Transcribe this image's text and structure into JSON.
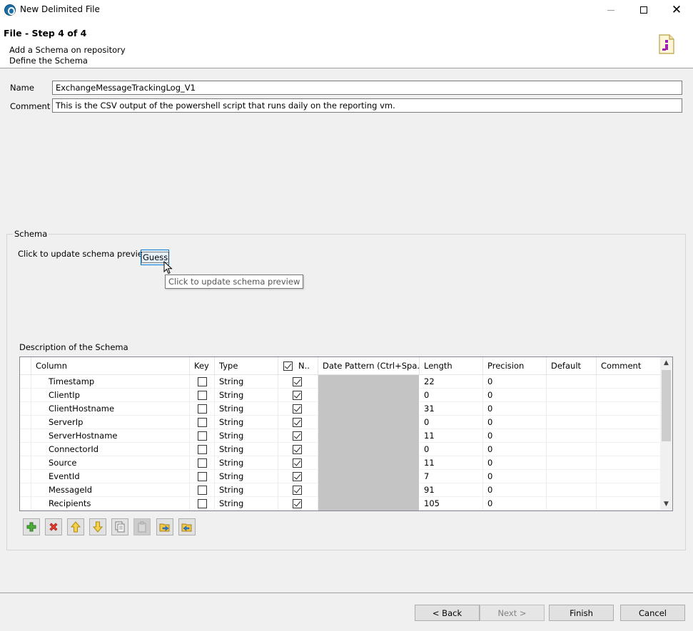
{
  "window": {
    "title": "New Delimited File",
    "minimize_glyph": "",
    "maximize_glyph": "",
    "close_glyph": "✕"
  },
  "header": {
    "step_title": "File - Step 4 of 4",
    "desc_line1": "Add a Schema on repository",
    "desc_line2": "Define the Schema"
  },
  "form": {
    "name_label": "Name",
    "name_value": "ExchangeMessageTrackingLog_V1",
    "comment_label": "Comment",
    "comment_value": "This is the CSV output of the powershell script that runs daily on the reporting vm."
  },
  "schema": {
    "group_label": "Schema",
    "guess_label": "Click to update schema preview",
    "guess_button": "Guess",
    "tooltip": "Click to update schema preview",
    "description_label": "Description of the Schema"
  },
  "table": {
    "headers": {
      "column": "Column",
      "key": "Key",
      "type": "Type",
      "nullable": "N..",
      "date_pattern": "Date Pattern (Ctrl+Spa...",
      "length": "Length",
      "precision": "Precision",
      "default": "Default",
      "comment": "Comment"
    },
    "nullable_header_checked": true,
    "rows": [
      {
        "column": "Timestamp",
        "key": false,
        "type": "String",
        "nullable": true,
        "length": "22",
        "precision": "0"
      },
      {
        "column": "ClientIp",
        "key": false,
        "type": "String",
        "nullable": true,
        "length": "0",
        "precision": "0"
      },
      {
        "column": "ClientHostname",
        "key": false,
        "type": "String",
        "nullable": true,
        "length": "31",
        "precision": "0"
      },
      {
        "column": "ServerIp",
        "key": false,
        "type": "String",
        "nullable": true,
        "length": "0",
        "precision": "0"
      },
      {
        "column": "ServerHostname",
        "key": false,
        "type": "String",
        "nullable": true,
        "length": "11",
        "precision": "0"
      },
      {
        "column": "ConnectorId",
        "key": false,
        "type": "String",
        "nullable": true,
        "length": "0",
        "precision": "0"
      },
      {
        "column": "Source",
        "key": false,
        "type": "String",
        "nullable": true,
        "length": "11",
        "precision": "0"
      },
      {
        "column": "EventId",
        "key": false,
        "type": "String",
        "nullable": true,
        "length": "7",
        "precision": "0"
      },
      {
        "column": "MessageId",
        "key": false,
        "type": "String",
        "nullable": true,
        "length": "91",
        "precision": "0"
      },
      {
        "column": "Recipients",
        "key": false,
        "type": "String",
        "nullable": true,
        "length": "105",
        "precision": "0"
      }
    ]
  },
  "toolbar": {
    "icons": [
      "add-icon",
      "remove-icon",
      "move-up-icon",
      "move-down-icon",
      "copy-icon",
      "paste-icon",
      "import-icon",
      "export-icon"
    ]
  },
  "buttons": {
    "back": "< Back",
    "next": "Next >",
    "finish": "Finish",
    "cancel": "Cancel"
  },
  "colors": {
    "focus_blue": "#0078d7",
    "date_pattern_cell": "#c4c4c4",
    "add_green": "#3c9a2e",
    "remove_red": "#d9342b",
    "arrow_yellow": "#f1c232"
  }
}
